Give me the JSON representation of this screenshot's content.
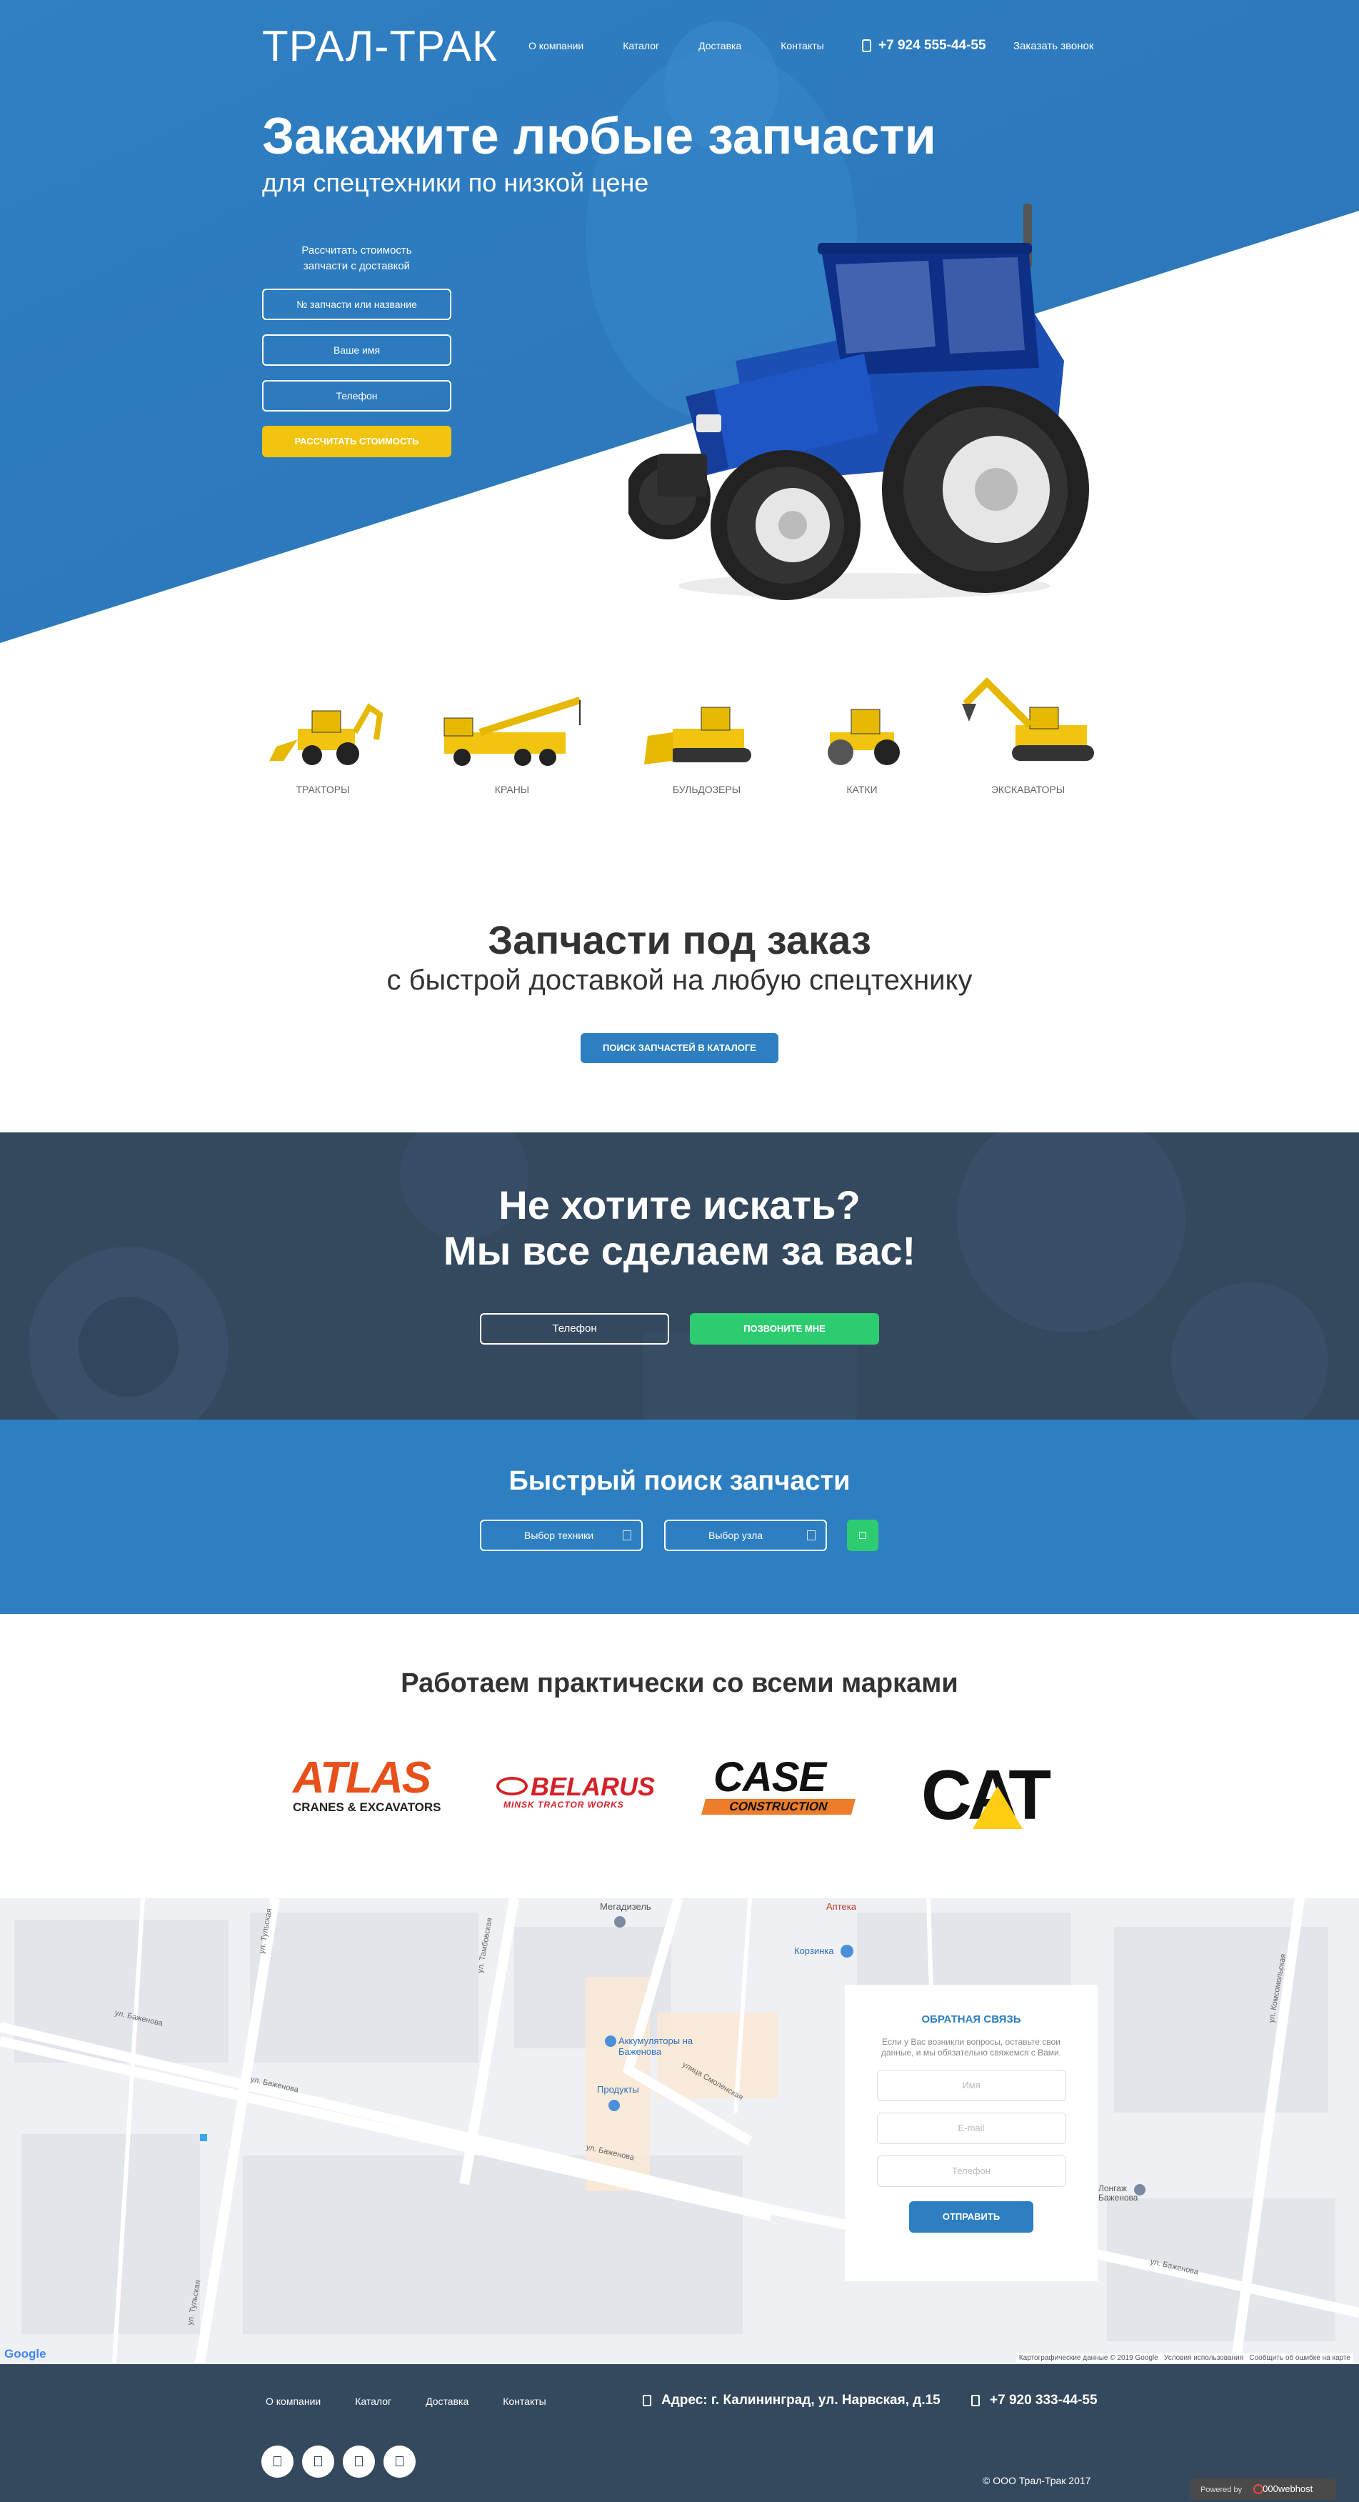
{
  "header": {
    "logo": "ТРАЛ-ТРАК",
    "nav": [
      "О компании",
      "Каталог",
      "Доставка",
      "Контакты"
    ],
    "phone": "+7 924 555-44-55",
    "callback": "Заказать звонок"
  },
  "hero": {
    "title": "Закажите любые запчасти",
    "subtitle": "для спецтехники по низкой цене",
    "form_caption_1": "Рассчитать стоимость",
    "form_caption_2": "запчасти с доставкой",
    "field_part": "№ запчасти или название",
    "field_name": "Ваше имя",
    "field_phone": "Телефон",
    "submit": "РАССЧИТАТЬ СТОИМОСТЬ"
  },
  "machines": [
    {
      "label": "ТРАКТОРЫ",
      "icon": "backhoe-loader-icon"
    },
    {
      "label": "КРАНЫ",
      "icon": "crane-truck-icon"
    },
    {
      "label": "БУЛЬДОЗЕРЫ",
      "icon": "bulldozer-icon"
    },
    {
      "label": "КАТКИ",
      "icon": "road-roller-icon"
    },
    {
      "label": "ЭКСКАВАТОРЫ",
      "icon": "excavator-icon"
    }
  ],
  "parts": {
    "title": "Запчасти под заказ",
    "subtitle": "с быстрой доставкой на любую спецтехнику",
    "button": "ПОИСК ЗАПЧАСТЕЙ В КАТАЛОГЕ"
  },
  "cta": {
    "line1": "Не хотите искать?",
    "line2": "Мы все сделаем за вас!",
    "phone_field": "Телефон",
    "button": "ПОЗВОНИТЕ МНЕ"
  },
  "quick_search": {
    "title": "Быстрый поиск запчасти",
    "select_machine": "Выбор техники",
    "select_unit": "Выбор узла"
  },
  "brands": {
    "title": "Работаем практически со всеми марками",
    "atlas_line1": "ATLAS",
    "atlas_line2": "CRANES & EXCAVATORS",
    "belarus_line1": "BELARUS",
    "belarus_line2": "MINSK TRACTOR WORKS",
    "case_line1": "CASE",
    "case_line2": "CONSTRUCTION",
    "cat": "CAT"
  },
  "map": {
    "streets": [
      "ул. Тульская",
      "ул. Тамбовская",
      "ул. Баженова",
      "ул. Баженова",
      "ул. Баженова",
      "ул. Тульская",
      "улица Смоленская",
      "ул. Комсомольская",
      "ул. Баженова"
    ],
    "pois": [
      "Мегадизель",
      "Аптека",
      "Корзинка",
      "Аккумуляторы на Баженова",
      "Продукты",
      "Лонгаж Баженова"
    ],
    "google": "Google",
    "map_data": "Картографические данные © 2019 Google",
    "terms": "Условия использования",
    "report": "Сообщить об ошибке на карте"
  },
  "feedback": {
    "title": "ОБРАТНАЯ СВЯЗЬ",
    "text": "Если у Вас возникли вопросы, оставьте свои данные, и мы обязательно свяжемся с Вами.",
    "name": "Имя",
    "email": "E-mail",
    "phone": "Телефон",
    "submit": "ОТПРАВИТЬ"
  },
  "footer": {
    "nav": [
      "О компании",
      "Каталог",
      "Доставка",
      "Контакты"
    ],
    "address": "Адрес: г. Калининград, ул. Нарвская, д.15",
    "phone": "+7 920 333-44-55",
    "copyright": "© ООО Трал-Трак 2017",
    "hosted_prefix": "Powered by",
    "hosted_name": "000webhost"
  },
  "colors": {
    "primary_blue": "#2d7fc1",
    "dark": "#34495e",
    "yellow": "#f1c40f",
    "green": "#2ecc71"
  }
}
